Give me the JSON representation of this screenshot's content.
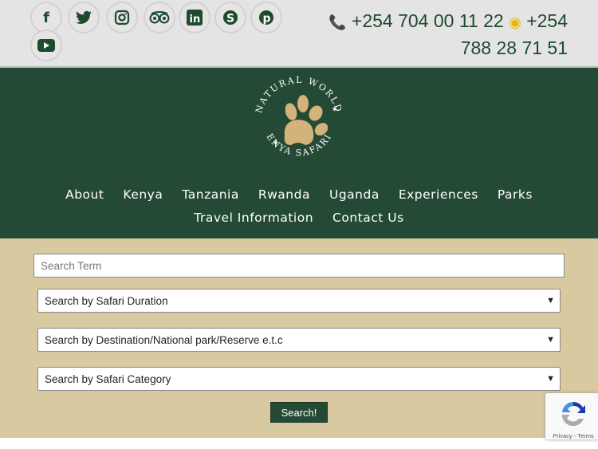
{
  "social": [
    {
      "name": "facebook",
      "glyph": "f"
    },
    {
      "name": "twitter",
      "glyph": "🐦"
    },
    {
      "name": "instagram",
      "glyph": "◎"
    },
    {
      "name": "tripadvisor",
      "glyph": "ꝏ"
    },
    {
      "name": "linkedin",
      "glyph": "in"
    },
    {
      "name": "skype",
      "glyph": "S"
    },
    {
      "name": "pinterest",
      "glyph": "P"
    },
    {
      "name": "youtube",
      "glyph": "▶"
    }
  ],
  "contact": {
    "phone": "+254 704 00 11 22",
    "whatsapp": "+254 788 28 71 51"
  },
  "logo": {
    "top": "NATURAL WORLD",
    "bottom": "KENYA SAFARIS"
  },
  "nav": [
    "About",
    "Kenya",
    "Tanzania",
    "Rwanda",
    "Uganda",
    "Experiences",
    "Parks",
    "Travel Information",
    "Contact Us"
  ],
  "search": {
    "placeholder": "Search Term",
    "duration": "Search by Safari Duration",
    "destination": "Search by Destination/National park/Reserve e.t.c",
    "category": "Search by Safari Category",
    "button": "Search!"
  },
  "recaptcha": {
    "links": "Privacy - Terms"
  },
  "colors": {
    "green": "#244a35",
    "tan": "#d9c9a0",
    "accent": "#e6b800"
  }
}
